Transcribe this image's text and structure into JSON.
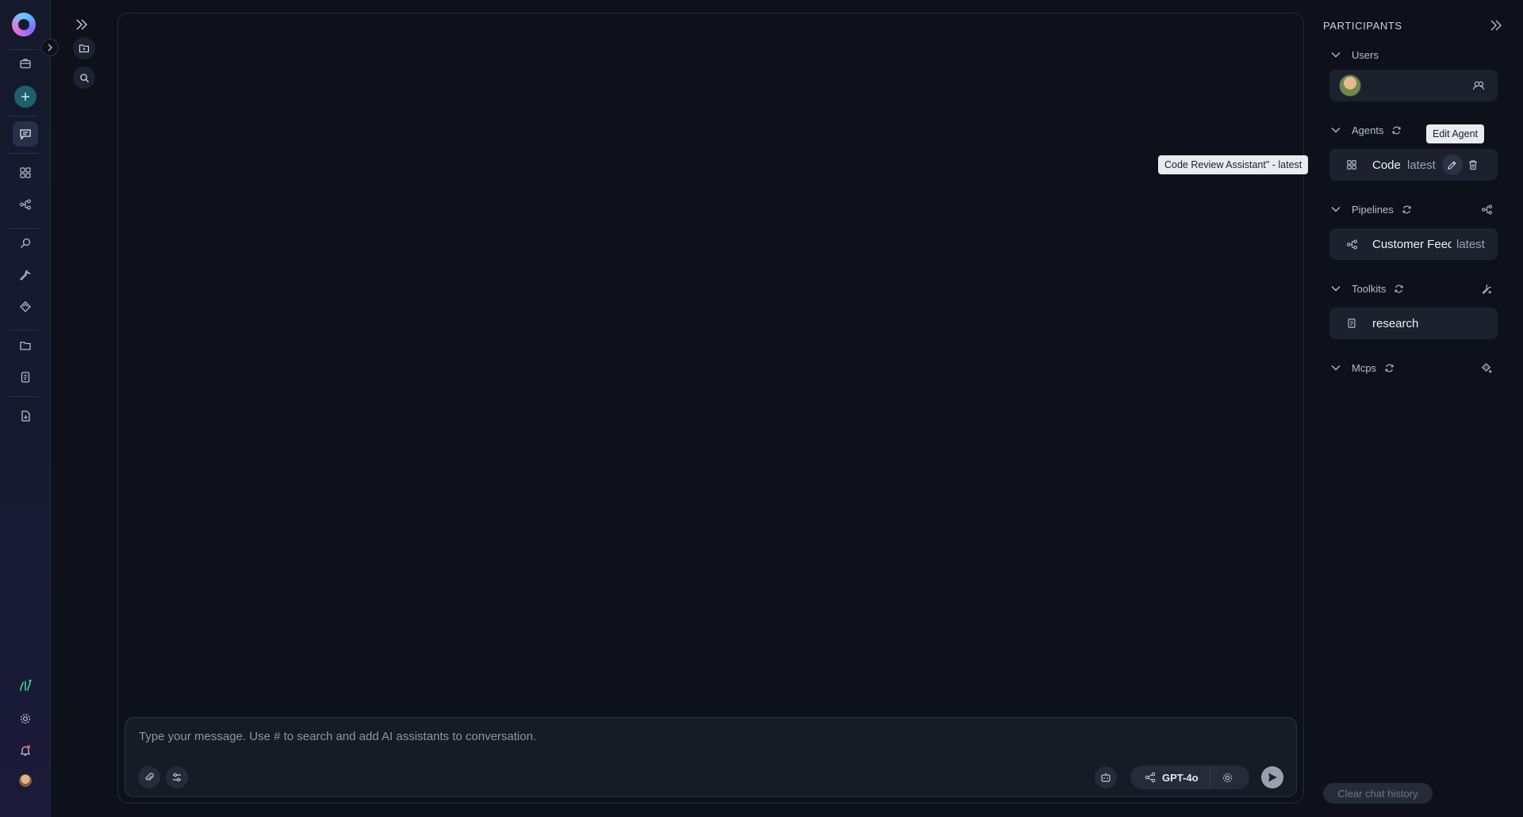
{
  "sidebar": {
    "icons": [
      "logo",
      "expand-icon",
      "briefcase-icon",
      "plus-icon",
      "chat-icon",
      "grid-icon",
      "pipeline-icon",
      "search-icon",
      "wrench-icon",
      "diamond-icon",
      "folder-icon",
      "document-icon",
      "file-icon",
      "signal-icon",
      "settings-icon",
      "bell-icon",
      "user-avatar"
    ]
  },
  "conversations": {
    "icons": [
      "double-chevron-right-icon",
      "folder-play-icon",
      "search-icon"
    ]
  },
  "composer": {
    "placeholder": "Type your message. Use # to search and add AI assistants to conversation.",
    "model_label": "GPT-4o"
  },
  "participants": {
    "title": "PARTICIPANTS",
    "sections": {
      "users": {
        "label": "Users"
      },
      "agents": {
        "label": "Agents",
        "item_name": "Code",
        "item_version": "latest"
      },
      "pipelines": {
        "label": "Pipelines",
        "item_name": "Customer Feedback",
        "item_version": "latest"
      },
      "toolkits": {
        "label": "Toolkits",
        "item_name": "research"
      },
      "mcps": {
        "label": "Mcps"
      }
    },
    "clear_button": "Clear chat history"
  },
  "tooltips": {
    "edit_agent": "Edit Agent",
    "agent_full_name": "Code Review Assistant\" - latest"
  },
  "colors": {
    "background": "#0e1119",
    "accent_teal": "#1f5f6b",
    "card": "#1d212d"
  }
}
